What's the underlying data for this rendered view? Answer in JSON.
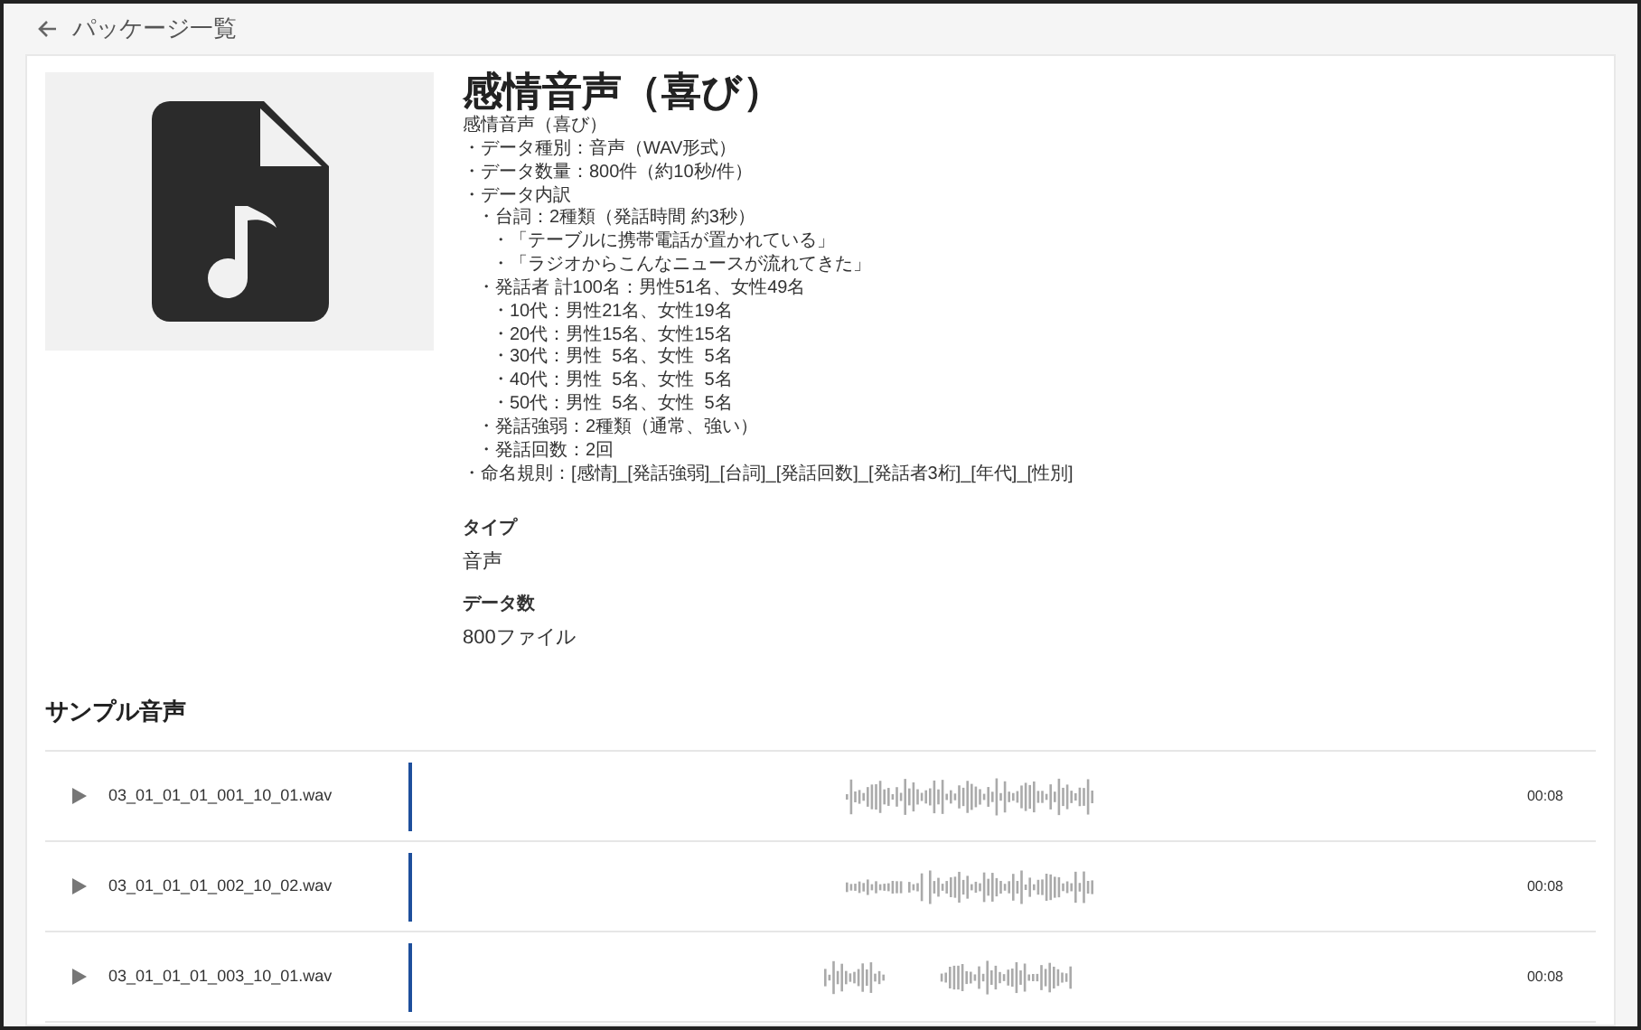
{
  "header": {
    "back_label": "パッケージ一覧"
  },
  "package": {
    "title": "感情音声（喜び）",
    "description": [
      {
        "text": "感情音声（喜び）"
      },
      {
        "text": "・データ種別：音声（WAV形式）"
      },
      {
        "text": "・データ数量：800件（約10秒/件）"
      },
      {
        "text": "・データ内訳",
        "children": [
          {
            "text": "・台詞：2種類（発話時間 約3秒）",
            "children": [
              {
                "text": "・「テーブルに携帯電話が置かれている」"
              },
              {
                "text": "・「ラジオからこんなニュースが流れてきた」"
              }
            ]
          },
          {
            "text": "・発話者 計100名：男性51名、女性49名",
            "children": [
              {
                "text": "・10代：男性21名、女性19名"
              },
              {
                "text": "・20代：男性15名、女性15名"
              },
              {
                "text": "・30代：男性  5名、女性  5名"
              },
              {
                "text": "・40代：男性  5名、女性  5名"
              },
              {
                "text": "・50代：男性  5名、女性  5名"
              }
            ]
          },
          {
            "text": "・発話強弱：2種類（通常、強い）"
          },
          {
            "text": "・発話回数：2回"
          }
        ]
      },
      {
        "text": "・命名規則：[感情]_[発話強弱]_[台詞]_[発話回数]_[発話者3桁]_[年代]_[性別]"
      }
    ],
    "fields": [
      {
        "label": "タイプ",
        "value": "音声"
      },
      {
        "label": "データ数",
        "value": "800ファイル"
      }
    ]
  },
  "samples": {
    "heading": "サンプル音声",
    "rows": [
      {
        "file": "03_01_01_01_001_10_01.wav",
        "duration": "00:08"
      },
      {
        "file": "03_01_01_01_002_10_02.wav",
        "duration": "00:08"
      },
      {
        "file": "03_01_01_01_003_10_01.wav",
        "duration": "00:08"
      }
    ]
  }
}
